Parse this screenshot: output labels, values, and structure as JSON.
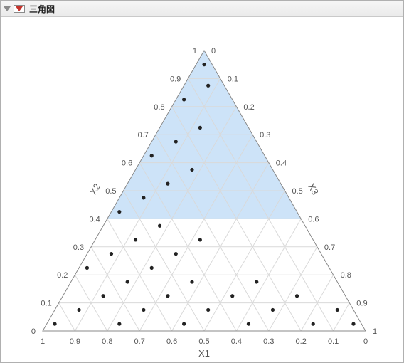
{
  "header": {
    "title": "三角図"
  },
  "chart_data": {
    "type": "ternary",
    "axes": {
      "bottom": {
        "label": "X1",
        "ticks": [
          1,
          0.9,
          0.8,
          0.7,
          0.6,
          0.5,
          0.4,
          0.3,
          0.2,
          0.1,
          0
        ]
      },
      "left": {
        "label": "X2",
        "ticks": [
          0,
          0.1,
          0.2,
          0.3,
          0.4,
          0.5,
          0.6,
          0.7,
          0.8,
          0.9,
          1
        ]
      },
      "right": {
        "label": "X3",
        "ticks": [
          0,
          0.1,
          0.2,
          0.3,
          0.4,
          0.5,
          0.6,
          0.7,
          0.8,
          0.9,
          1
        ]
      }
    },
    "constraint_region": {
      "description": "X2 >= 0.40 (upper shaded region)",
      "inequality": "x2 >= 0.40",
      "vertices_abc": [
        [
          0.6,
          0.4,
          0.0
        ],
        [
          0.0,
          1.0,
          0.0
        ],
        [
          0.0,
          0.4,
          0.6
        ]
      ]
    },
    "grid_step": 0.1,
    "points_abc": [
      [
        0.95,
        0.025,
        0.025
      ],
      [
        0.85,
        0.075,
        0.075
      ],
      [
        0.75,
        0.025,
        0.225
      ],
      [
        0.75,
        0.125,
        0.125
      ],
      [
        0.75,
        0.225,
        0.025
      ],
      [
        0.65,
        0.075,
        0.275
      ],
      [
        0.65,
        0.175,
        0.175
      ],
      [
        0.65,
        0.275,
        0.075
      ],
      [
        0.55,
        0.025,
        0.425
      ],
      [
        0.55,
        0.125,
        0.325
      ],
      [
        0.55,
        0.225,
        0.225
      ],
      [
        0.55,
        0.325,
        0.125
      ],
      [
        0.55,
        0.425,
        0.025
      ],
      [
        0.45,
        0.075,
        0.475
      ],
      [
        0.45,
        0.175,
        0.375
      ],
      [
        0.45,
        0.275,
        0.275
      ],
      [
        0.45,
        0.375,
        0.175
      ],
      [
        0.45,
        0.475,
        0.075
      ],
      [
        0.35,
        0.025,
        0.625
      ],
      [
        0.35,
        0.125,
        0.525
      ],
      [
        0.35,
        0.325,
        0.325
      ],
      [
        0.35,
        0.525,
        0.125
      ],
      [
        0.35,
        0.625,
        0.025
      ],
      [
        0.25,
        0.075,
        0.675
      ],
      [
        0.25,
        0.175,
        0.575
      ],
      [
        0.25,
        0.575,
        0.175
      ],
      [
        0.25,
        0.675,
        0.075
      ],
      [
        0.15,
        0.025,
        0.825
      ],
      [
        0.15,
        0.125,
        0.725
      ],
      [
        0.15,
        0.725,
        0.125
      ],
      [
        0.15,
        0.825,
        0.025
      ],
      [
        0.05,
        0.075,
        0.875
      ],
      [
        0.05,
        0.875,
        0.075
      ],
      [
        0.025,
        0.025,
        0.95
      ],
      [
        0.025,
        0.95,
        0.025
      ]
    ]
  }
}
